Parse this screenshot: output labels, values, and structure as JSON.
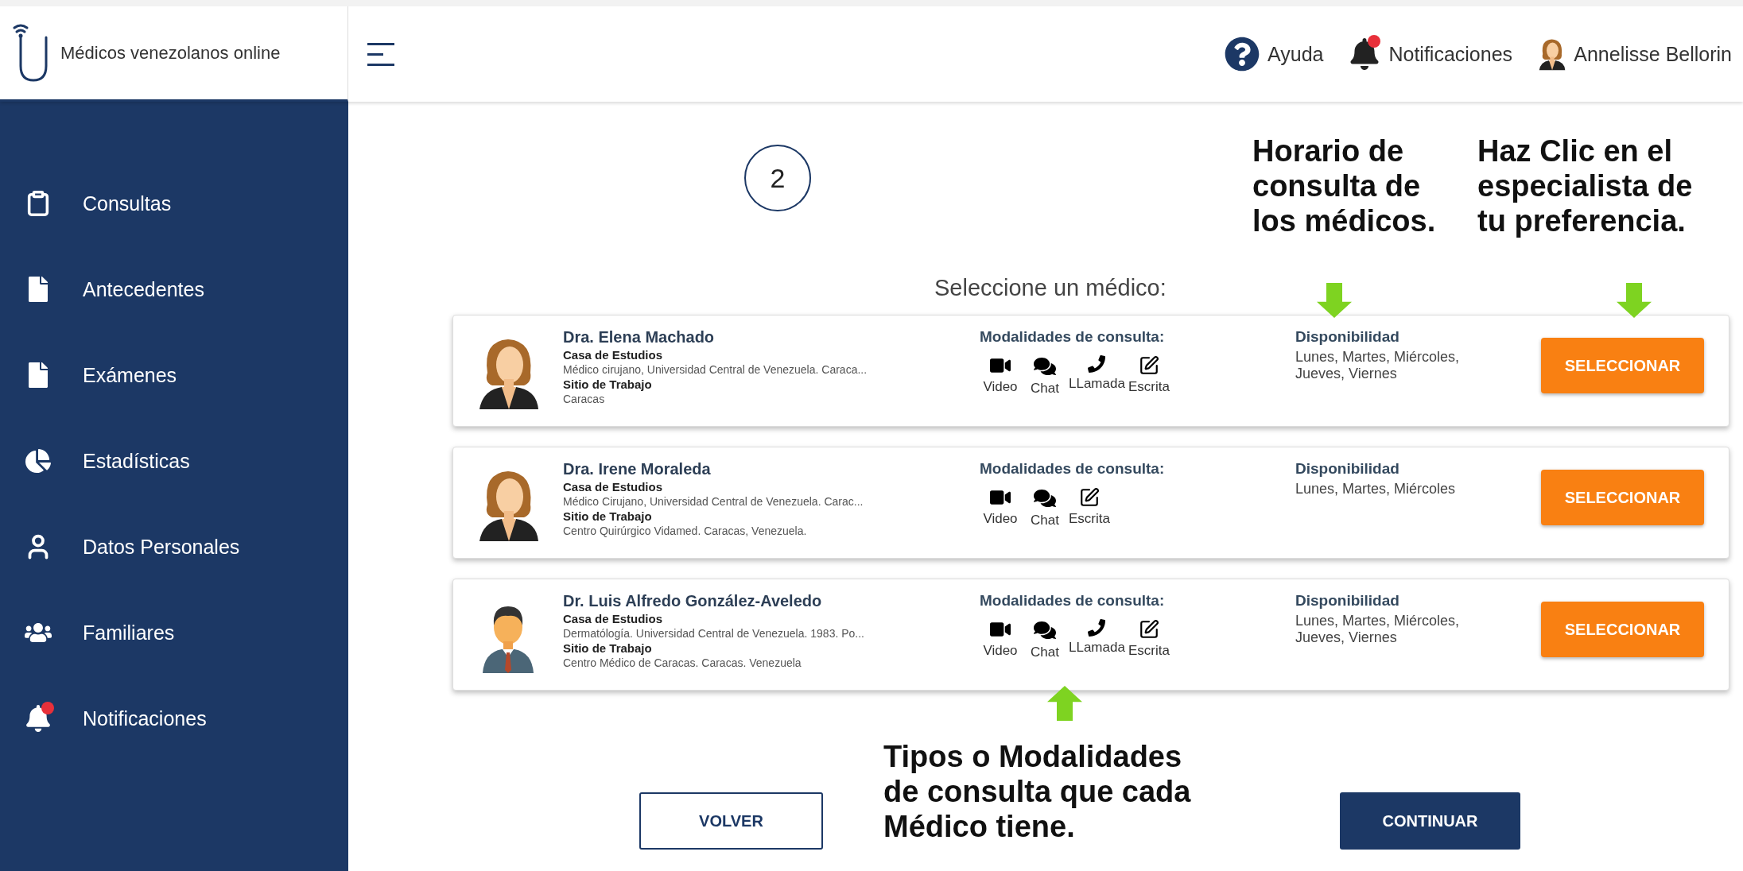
{
  "header": {
    "brand": "Médicos venezolanos online",
    "help": "Ayuda",
    "notifications": "Notificaciones",
    "user": "Annelisse Bellorin"
  },
  "sidebar": {
    "items": [
      {
        "label": "Consultas"
      },
      {
        "label": "Antecedentes"
      },
      {
        "label": "Exámenes"
      },
      {
        "label": "Estadísticas"
      },
      {
        "label": "Datos Personales"
      },
      {
        "label": "Familiares"
      },
      {
        "label": "Notificaciones"
      }
    ]
  },
  "step": "2",
  "prompt": "Seleccione un médico:",
  "doctors": [
    {
      "kind": "female",
      "name": "Dra. Elena Machado",
      "school_label": "Casa de Estudios",
      "school": "Médico cirujano, Universidad Central de Venezuela. Caraca...",
      "work_label": "Sitio de Trabajo",
      "work": "Caracas",
      "modalities_label": "Modalidades de consulta:",
      "modalities": [
        {
          "kind": "video",
          "label": "Video"
        },
        {
          "kind": "chat",
          "label": "Chat"
        },
        {
          "kind": "call",
          "label": "LLamada"
        },
        {
          "kind": "written",
          "label": "Escrita"
        }
      ],
      "availability_label": "Disponibilidad",
      "availability": "Lunes, Martes, Miércoles, Jueves, Viernes",
      "button": "SELECCIONAR"
    },
    {
      "kind": "female",
      "name": "Dra. Irene Moraleda",
      "school_label": "Casa de Estudios",
      "school": "Médico Cirujano, Universidad Central de Venezuela. Carac...",
      "work_label": "Sitio de Trabajo",
      "work": "Centro Quirúrgico Vidamed. Caracas, Venezuela.",
      "modalities_label": "Modalidades de consulta:",
      "modalities": [
        {
          "kind": "video",
          "label": "Video"
        },
        {
          "kind": "chat",
          "label": "Chat"
        },
        {
          "kind": "written",
          "label": "Escrita"
        }
      ],
      "availability_label": "Disponibilidad",
      "availability": "Lunes, Martes, Miércoles",
      "button": "SELECCIONAR"
    },
    {
      "kind": "male",
      "name": "Dr. Luis Alfredo González-Aveledo",
      "school_label": "Casa de Estudios",
      "school": "Dermatólogía. Universidad Central de Venezuela. 1983. Po...",
      "work_label": "Sitio de Trabajo",
      "work": "Centro Médico de Caracas. Caracas. Venezuela",
      "modalities_label": "Modalidades de consulta:",
      "modalities": [
        {
          "kind": "video",
          "label": "Video"
        },
        {
          "kind": "chat",
          "label": "Chat"
        },
        {
          "kind": "call",
          "label": "LLamada"
        },
        {
          "kind": "written",
          "label": "Escrita"
        }
      ],
      "availability_label": "Disponibilidad",
      "availability": "Lunes, Martes, Miércoles, Jueves, Viernes",
      "button": "SELECCIONAR"
    }
  ],
  "footer": {
    "back": "VOLVER",
    "continue": "CONTINUAR"
  },
  "annotations": [
    {
      "kind": "schedule",
      "text": "Horario de consulta de los médicos."
    },
    {
      "kind": "select",
      "text": "Haz Clic en el especialista de tu preferencia."
    },
    {
      "kind": "modalities",
      "text": "Tipos o Modalidades de consulta que cada Médico tiene."
    }
  ]
}
